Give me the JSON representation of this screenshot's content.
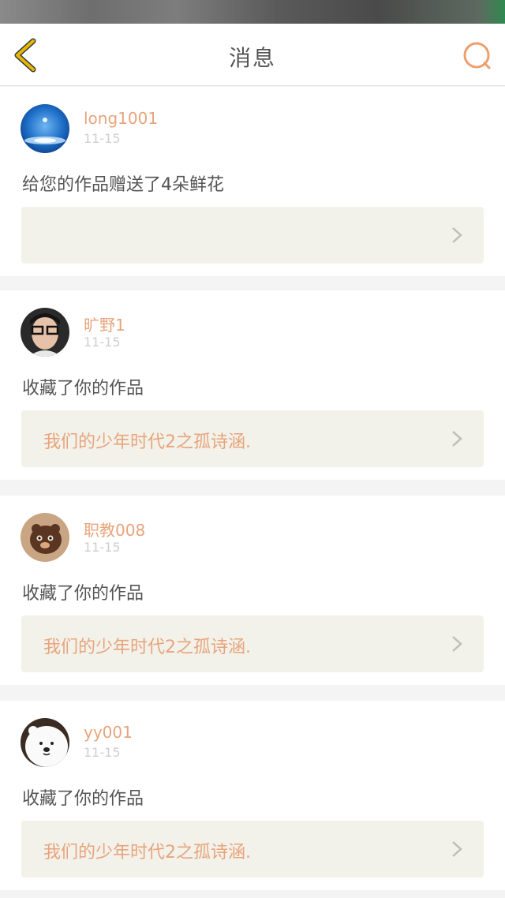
{
  "header": {
    "title": "消息"
  },
  "icons": {
    "back": "chevron-left-icon",
    "search": "search-icon"
  },
  "colors": {
    "accent": "#e8a47c",
    "back_icon": "#e3b800",
    "link_bg": "#f2f2ea"
  },
  "messages": [
    {
      "username": "long1001",
      "date": "11-15",
      "action": "给您的作品赠送了4朵鲜花",
      "work_title": ""
    },
    {
      "username": "旷野1",
      "date": "11-15",
      "action": "收藏了你的作品",
      "work_title": "我们的少年时代2之孤诗涵."
    },
    {
      "username": "职教008",
      "date": "11-15",
      "action": "收藏了你的作品",
      "work_title": "我们的少年时代2之孤诗涵."
    },
    {
      "username": "yy001",
      "date": "11-15",
      "action": "收藏了你的作品",
      "work_title": "我们的少年时代2之孤诗涵."
    }
  ]
}
